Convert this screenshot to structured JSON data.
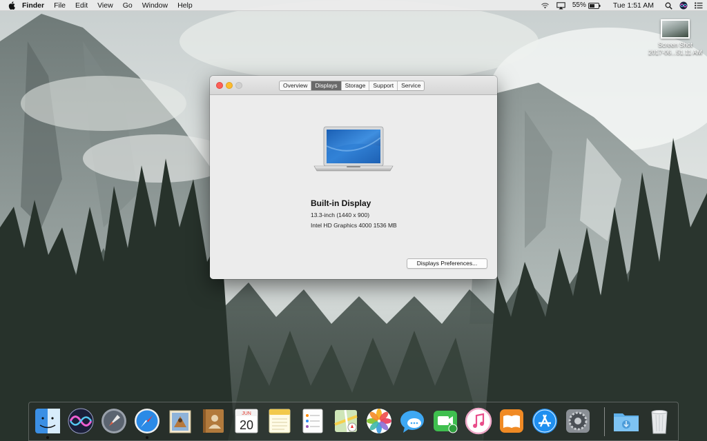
{
  "menubar": {
    "app_name": "Finder",
    "menus": [
      "File",
      "Edit",
      "View",
      "Go",
      "Window",
      "Help"
    ],
    "battery_percent": "55%",
    "clock": "Tue 1:51 AM",
    "icons": [
      "apple-icon",
      "wifi-icon",
      "airplay-icon",
      "battery-icon",
      "spotlight-icon",
      "siri-icon",
      "notification-center-icon"
    ]
  },
  "desktop": {
    "file": {
      "name_line1": "Screen Shot",
      "name_line2": "2017-06...51.11 AM"
    }
  },
  "about_window": {
    "tabs": [
      "Overview",
      "Displays",
      "Storage",
      "Support",
      "Service"
    ],
    "active_tab": "Displays",
    "display_name": "Built-in Display",
    "display_size": "13.3-inch (1440 x 900)",
    "graphics": "Intel HD Graphics 4000 1536 MB",
    "prefs_button": "Displays Preferences..."
  },
  "dock": {
    "apps": [
      {
        "name": "Finder",
        "icon": "finder-icon",
        "running": true
      },
      {
        "name": "Siri",
        "icon": "siri-icon",
        "running": false
      },
      {
        "name": "Launchpad",
        "icon": "launchpad-icon",
        "running": false
      },
      {
        "name": "Safari",
        "icon": "safari-icon",
        "running": true
      },
      {
        "name": "Mail",
        "icon": "mail-icon",
        "running": false
      },
      {
        "name": "Contacts",
        "icon": "contacts-icon",
        "running": false
      },
      {
        "name": "Calendar",
        "icon": "calendar-icon",
        "running": false,
        "month": "JUN",
        "day": "20"
      },
      {
        "name": "Notes",
        "icon": "notes-icon",
        "running": false
      },
      {
        "name": "Reminders",
        "icon": "reminders-icon",
        "running": false
      },
      {
        "name": "Maps",
        "icon": "maps-icon",
        "running": false
      },
      {
        "name": "Photos",
        "icon": "photos-icon",
        "running": false
      },
      {
        "name": "Messages",
        "icon": "messages-icon",
        "running": false
      },
      {
        "name": "FaceTime",
        "icon": "facetime-icon",
        "running": false
      },
      {
        "name": "iTunes",
        "icon": "itunes-icon",
        "running": false
      },
      {
        "name": "iBooks",
        "icon": "ibooks-icon",
        "running": false
      },
      {
        "name": "App Store",
        "icon": "app-store-icon",
        "running": false
      },
      {
        "name": "System Preferences",
        "icon": "system-preferences-icon",
        "running": false
      },
      {
        "name": "Downloads",
        "icon": "downloads-folder-icon",
        "running": false
      },
      {
        "name": "Trash",
        "icon": "trash-icon",
        "running": false
      }
    ]
  }
}
